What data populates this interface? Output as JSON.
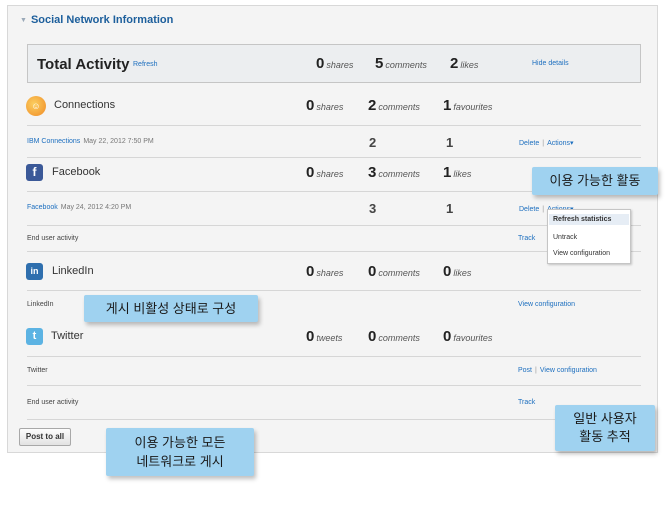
{
  "section": {
    "title": "Social Network Information"
  },
  "total": {
    "title": "Total Activity",
    "refresh": "Refresh",
    "shares_num": "0",
    "shares_unit": "shares",
    "comments_num": "5",
    "comments_unit": "comments",
    "likes_num": "2",
    "likes_unit": "likes",
    "hide_details": "Hide details"
  },
  "connections": {
    "name": "Connections",
    "shares_num": "0",
    "shares_unit": "shares",
    "comments_num": "2",
    "comments_unit": "comments",
    "favourites_num": "1",
    "favourites_unit": "favourites",
    "sub_link": "IBM Connections",
    "sub_date": "May 22, 2012 7:50 PM",
    "sub_comments": "2",
    "sub_likes": "1",
    "delete": "Delete",
    "actions": "Actions"
  },
  "facebook": {
    "name": "Facebook",
    "shares_num": "0",
    "shares_unit": "shares",
    "comments_num": "3",
    "comments_unit": "comments",
    "likes_num": "1",
    "likes_unit": "likes",
    "sub_link": "Facebook",
    "sub_date": "May 24, 2012 4:20 PM",
    "sub_comments": "3",
    "sub_likes": "1",
    "delete": "Delete",
    "actions": "Actions",
    "end_user": "End user activity",
    "track": "Track"
  },
  "actions_menu": {
    "items": [
      "Refresh statistics",
      "Untrack",
      "View configuration"
    ]
  },
  "linkedin": {
    "name": "LinkedIn",
    "shares_num": "0",
    "shares_unit": "shares",
    "comments_num": "0",
    "comments_unit": "comments",
    "likes_num": "0",
    "likes_unit": "likes",
    "sub_label": "LinkedIn",
    "view_config": "View configuration"
  },
  "twitter": {
    "name": "Twitter",
    "tweets_num": "0",
    "tweets_unit": "tweets",
    "comments_num": "0",
    "comments_unit": "comments",
    "favourites_num": "0",
    "favourites_unit": "favourites",
    "sub_label": "Twitter",
    "post": "Post",
    "view_config": "View configuration",
    "end_user": "End user activity",
    "track": "Track"
  },
  "post_all": "Post to all",
  "callouts": {
    "available_activity": "이용 가능한 활동",
    "disabled_posting": "게시 비활성 상태로 구성",
    "track_line1": "일반 사용자",
    "track_line2": "활동 추적",
    "post_all_line1": "이용 가능한 모든",
    "post_all_line2": "네트워크로 게시"
  },
  "colors": {
    "link": "#1d6fbf",
    "callout": "#9fd2f0",
    "header": "#1d5f9c"
  },
  "icons": [
    "connections-icon",
    "facebook-icon",
    "linkedin-icon",
    "twitter-icon"
  ]
}
